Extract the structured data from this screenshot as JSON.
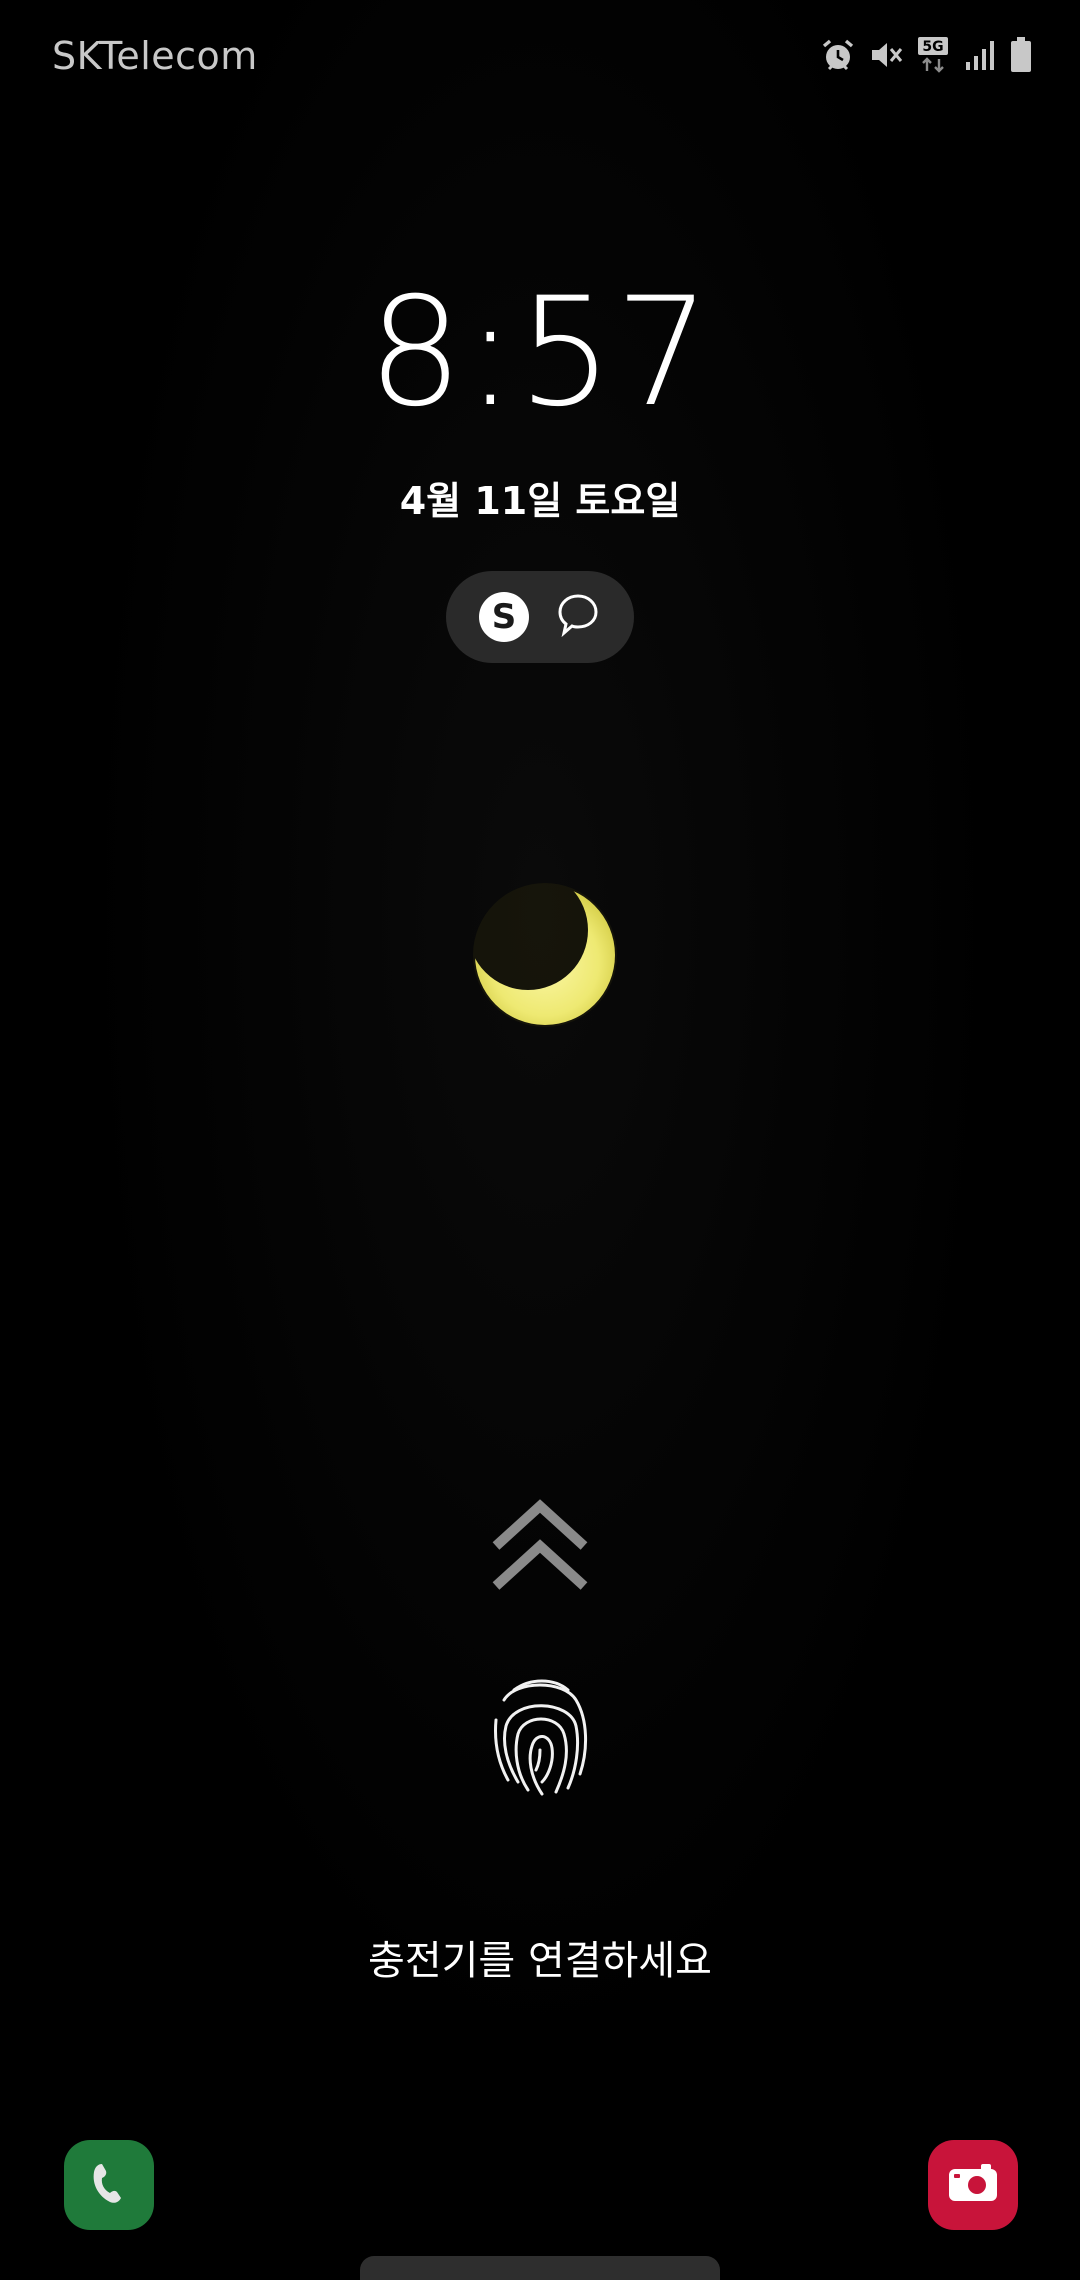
{
  "status_bar": {
    "carrier": "SKTelecom",
    "icons": [
      "alarm-icon",
      "mute-icon",
      "5g-icon",
      "signal-icon",
      "battery-icon"
    ],
    "network_label": "5G"
  },
  "lock_screen": {
    "time": "8:57",
    "date": "4월 11일 토요일",
    "notification_icons": [
      {
        "name": "samsung-pay-icon",
        "glyph": "S"
      },
      {
        "name": "message-bubble-icon"
      }
    ],
    "wallpaper_subject": "crescent-moon",
    "charge_message": "충전기를 연결하세요"
  },
  "shortcuts": {
    "left": {
      "icon": "phone-icon",
      "color": "#1f7a3a"
    },
    "right": {
      "icon": "camera-icon",
      "color": "#c8143a"
    }
  },
  "colors": {
    "background": "#000000",
    "moon": "#f4f08a",
    "pill": "#2a2a2a"
  }
}
